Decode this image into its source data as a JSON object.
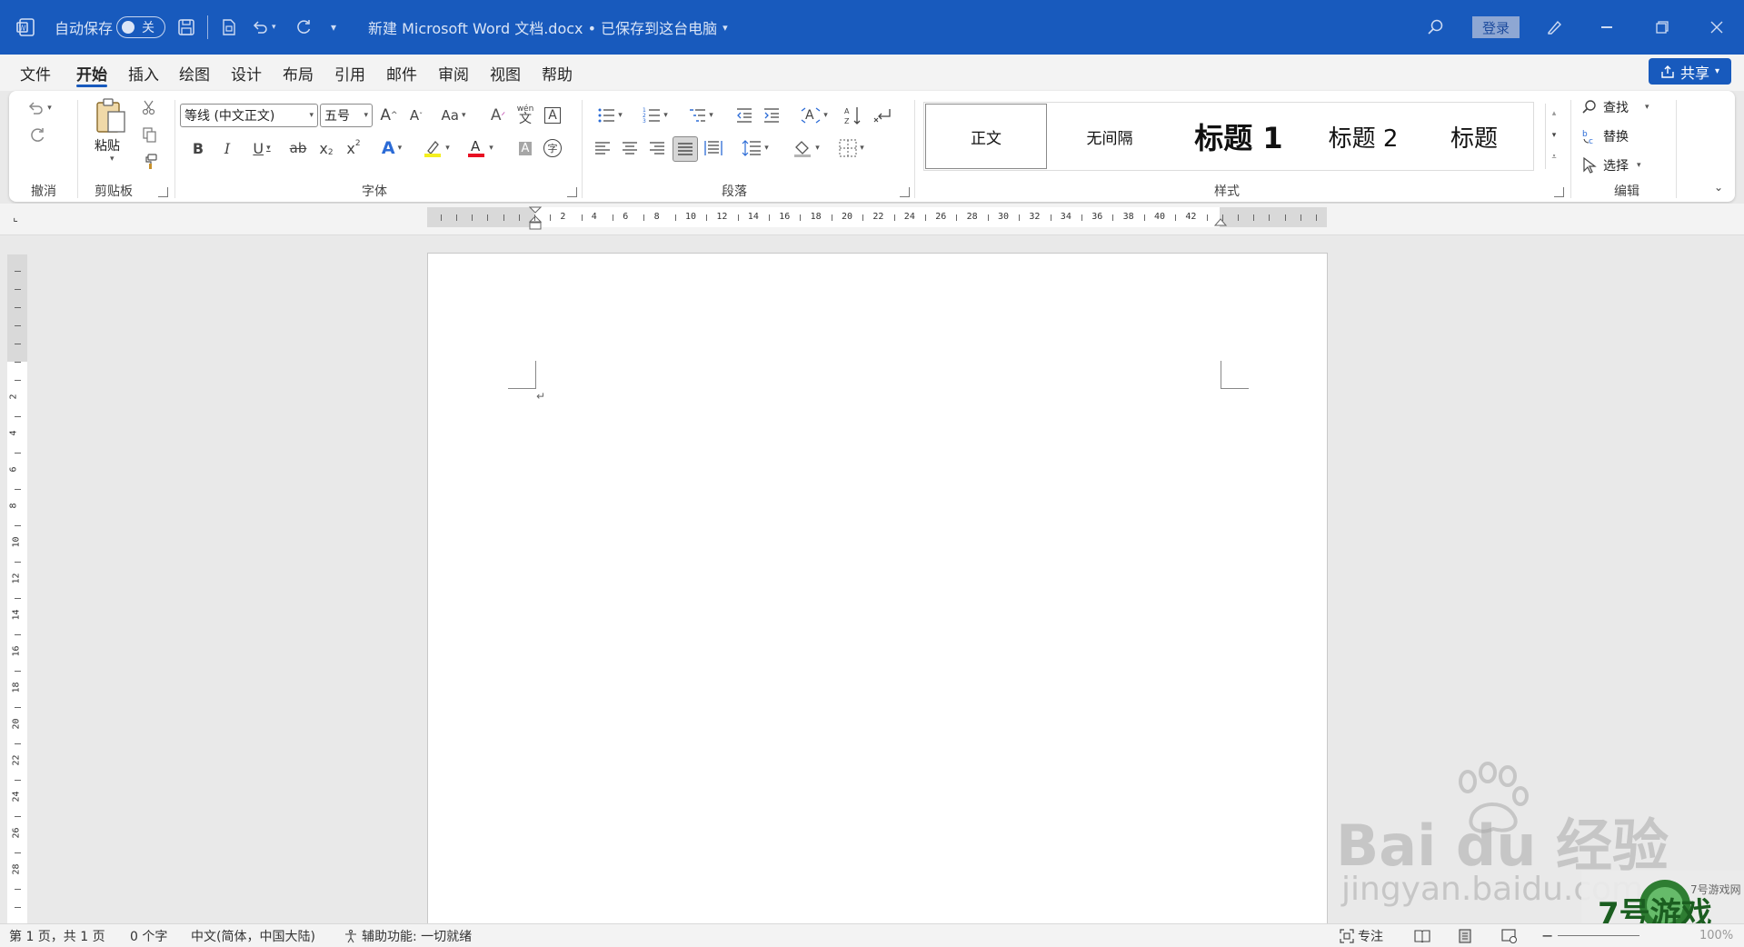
{
  "titlebar": {
    "autosave_label": "自动保存",
    "autosave_state": "关",
    "doc_title": "新建 Microsoft Word 文档.docx • 已保存到这台电脑",
    "login_label": "登录",
    "colors": {
      "bar": "#185abd"
    }
  },
  "tabs": [
    "文件",
    "开始",
    "插入",
    "绘图",
    "设计",
    "布局",
    "引用",
    "邮件",
    "审阅",
    "视图",
    "帮助"
  ],
  "active_tab": "开始",
  "share_label": "共享",
  "ribbon": {
    "groups": {
      "undo": "撤消",
      "clipboard": "剪贴板",
      "font": "字体",
      "paragraph": "段落",
      "styles": "样式",
      "editing": "编辑"
    },
    "paste_label": "粘贴",
    "font_name": "等线 (中文正文)",
    "font_size": "五号",
    "case_label": "Aa",
    "styles": [
      "正文",
      "无间隔",
      "标题 1",
      "标题 2",
      "标题"
    ],
    "find_label": "查找",
    "replace_label": "替换",
    "select_label": "选择"
  },
  "ruler": {
    "h_numbers": [
      "2",
      "4",
      "6",
      "8",
      "10",
      "12",
      "14",
      "16",
      "18",
      "20",
      "22",
      "24",
      "26",
      "28",
      "30",
      "32",
      "34",
      "36",
      "38",
      "40",
      "42"
    ],
    "v_numbers": [
      "2",
      "4",
      "6",
      "8",
      "10",
      "12",
      "14",
      "16",
      "18",
      "20",
      "22",
      "24",
      "26",
      "28"
    ]
  },
  "statusbar": {
    "page_info": "第 1 页，共 1 页",
    "word_count": "0 个字",
    "language": "中文(简体，中国大陆)",
    "accessibility": "辅助功能: 一切就绪",
    "focus_label": "专注",
    "zoom": "100%"
  },
  "watermark": {
    "baidu": "Bai du 经验",
    "url": "jingyan.baidu.com",
    "site": "7号游戏",
    "site_sub": "7号游戏网"
  }
}
